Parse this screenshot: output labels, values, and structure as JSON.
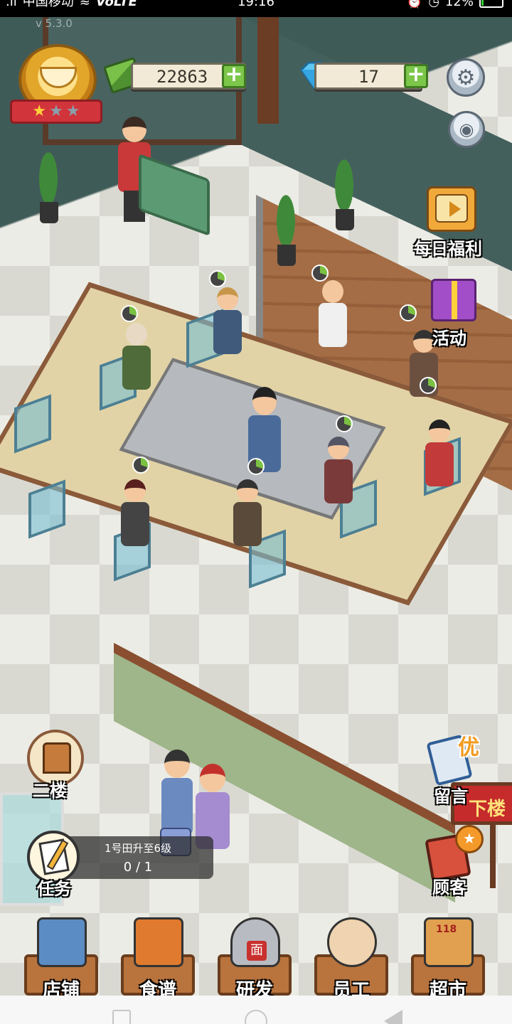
{
  "status_bar": {
    "signal": ".ıl",
    "carrier": "中国移动",
    "network": "VoLTE",
    "time": "19:16",
    "battery": "12%",
    "battery_level": 0.12
  },
  "hud": {
    "version": "v 5.3.0",
    "rating_stars": {
      "filled": 1,
      "total": 3
    },
    "cash": {
      "value": "22863",
      "plus": "+"
    },
    "gems": {
      "value": "17",
      "plus": "+"
    },
    "settings_icon": "gear-icon",
    "camera_icon": "camera-icon"
  },
  "side_buttons": {
    "daily_bonus": "每日福利",
    "event": "活动",
    "second_floor": "二楼",
    "tasks": "任务",
    "message": "留言",
    "message_tag": "优",
    "downstairs": "下楼",
    "customers": "顾客"
  },
  "task": {
    "title": "1号田升至6级",
    "progress": "0 / 1"
  },
  "bottom_nav": [
    {
      "label": "店铺",
      "icon": "shop-icon",
      "color": "#5b8cc4"
    },
    {
      "label": "食谱",
      "icon": "recipe-book-icon",
      "color": "#e07a2e"
    },
    {
      "label": "研发",
      "icon": "cooking-pot-icon",
      "color": "#b8bcc2",
      "pot_label": "面"
    },
    {
      "label": "员工",
      "icon": "staff-icon",
      "color": "#f0d3b0"
    },
    {
      "label": "超市",
      "icon": "supermarket-icon",
      "color": "#e0a050",
      "sign": "118"
    }
  ]
}
